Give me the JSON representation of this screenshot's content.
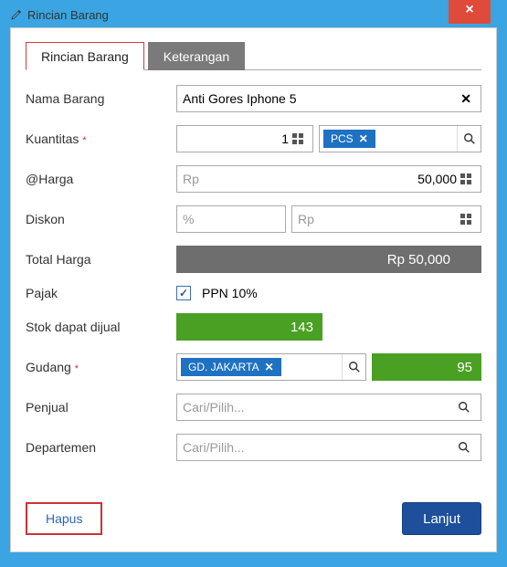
{
  "window": {
    "title": "Rincian Barang"
  },
  "tabs": {
    "rincian": "Rincian Barang",
    "keterangan": "Keterangan"
  },
  "labels": {
    "nama": "Nama Barang",
    "kuantitas": "Kuantitas",
    "harga": "@Harga",
    "diskon": "Diskon",
    "total": "Total Harga",
    "pajak": "Pajak",
    "stok": "Stok dapat dijual",
    "gudang": "Gudang",
    "penjual": "Penjual",
    "departemen": "Departemen"
  },
  "values": {
    "nama": "Anti Gores Iphone 5",
    "kuantitas": "1",
    "satuan": "PCS",
    "harga_prefix": "Rp",
    "harga": "50,000",
    "diskon_pct_ph": "%",
    "diskon_rp_ph": "Rp",
    "total": "Rp 50,000",
    "pajak_label": "PPN 10%",
    "pajak_checked": true,
    "stok": "143",
    "gudang": "GD. JAKARTA",
    "gudang_stok": "95",
    "lookup_ph": "Cari/Pilih..."
  },
  "buttons": {
    "hapus": "Hapus",
    "lanjut": "Lanjut"
  }
}
